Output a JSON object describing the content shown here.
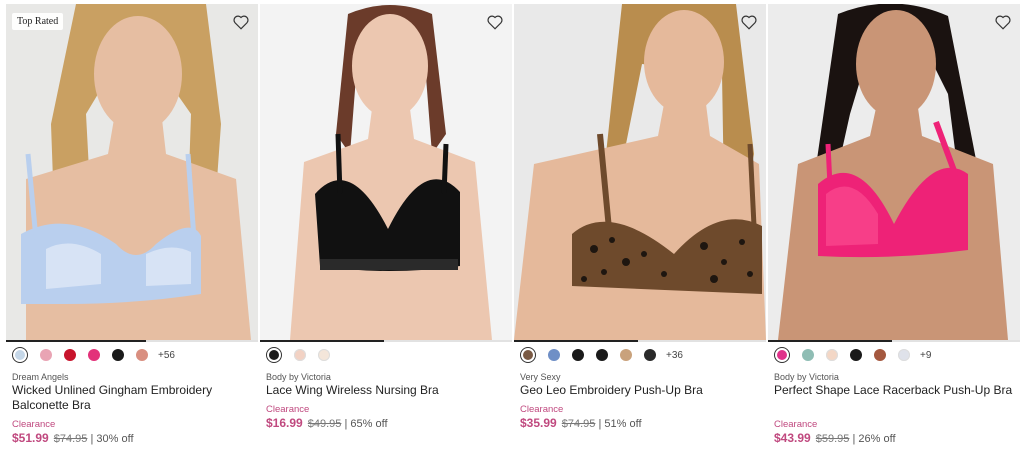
{
  "products": [
    {
      "badge": "Top Rated",
      "brand": "Dream Angels",
      "name": "Wicked Unlined Gingham Embroidery Balconette Bra",
      "clearance": "Clearance",
      "sale_price": "$51.99",
      "original_price": "$74.95",
      "discount": "| 30% off",
      "more_colors": "+56",
      "swatches": [
        "#c5d7e8",
        "#e9a4b4",
        "#c8142c",
        "#e3327a",
        "#1a1a1a",
        "#d98f80"
      ],
      "image": {
        "bg": "#e8e8e6",
        "hair": "#c9a062",
        "skin": "#e6bea2",
        "bra": "#b9cfee",
        "bra_accent": "#f0f4fb"
      }
    },
    {
      "badge": "",
      "brand": "Body by Victoria",
      "name": "Lace Wing Wireless Nursing Bra",
      "clearance": "Clearance",
      "sale_price": "$16.99",
      "original_price": "$49.95",
      "discount": "| 65% off",
      "more_colors": "",
      "swatches": [
        "#1a1a1a",
        "#f2d2c4",
        "#f4e6da"
      ],
      "image": {
        "bg": "#f3f3f3",
        "hair": "#6b3b2a",
        "skin": "#ecc7b0",
        "bra": "#111111",
        "bra_accent": "#2a2a2a"
      }
    },
    {
      "badge": "",
      "brand": "Very Sexy",
      "name": "Geo Leo Embroidery Push-Up Bra",
      "clearance": "Clearance",
      "sale_price": "$35.99",
      "original_price": "$74.95",
      "discount": "| 51% off",
      "more_colors": "+36",
      "swatches": [
        "#7a5a44",
        "#6f8fc6",
        "#1a1a1a",
        "#1a1a1a",
        "#c9a27c",
        "#2a2a2a"
      ],
      "image": {
        "bg": "#e9e9e9",
        "hair": "#b98d4e",
        "skin": "#e5b99b",
        "bra": "#6e4a2c",
        "bra_accent": "#1e1610"
      }
    },
    {
      "badge": "",
      "brand": "Body by Victoria",
      "name": "Perfect Shape Lace Racerback Push-Up Bra",
      "clearance": "Clearance",
      "sale_price": "$43.99",
      "original_price": "$59.95",
      "discount": "| 26% off",
      "more_colors": "+9",
      "swatches": [
        "#e0328a",
        "#8fbdb4",
        "#f3d7c6",
        "#1a1a1a",
        "#a4583f",
        "#dfe2ea"
      ],
      "image": {
        "bg": "#ececec",
        "hair": "#1a1210",
        "skin": "#c99576",
        "bra": "#ee2277",
        "bra_accent": "#ff5a9a"
      }
    }
  ]
}
